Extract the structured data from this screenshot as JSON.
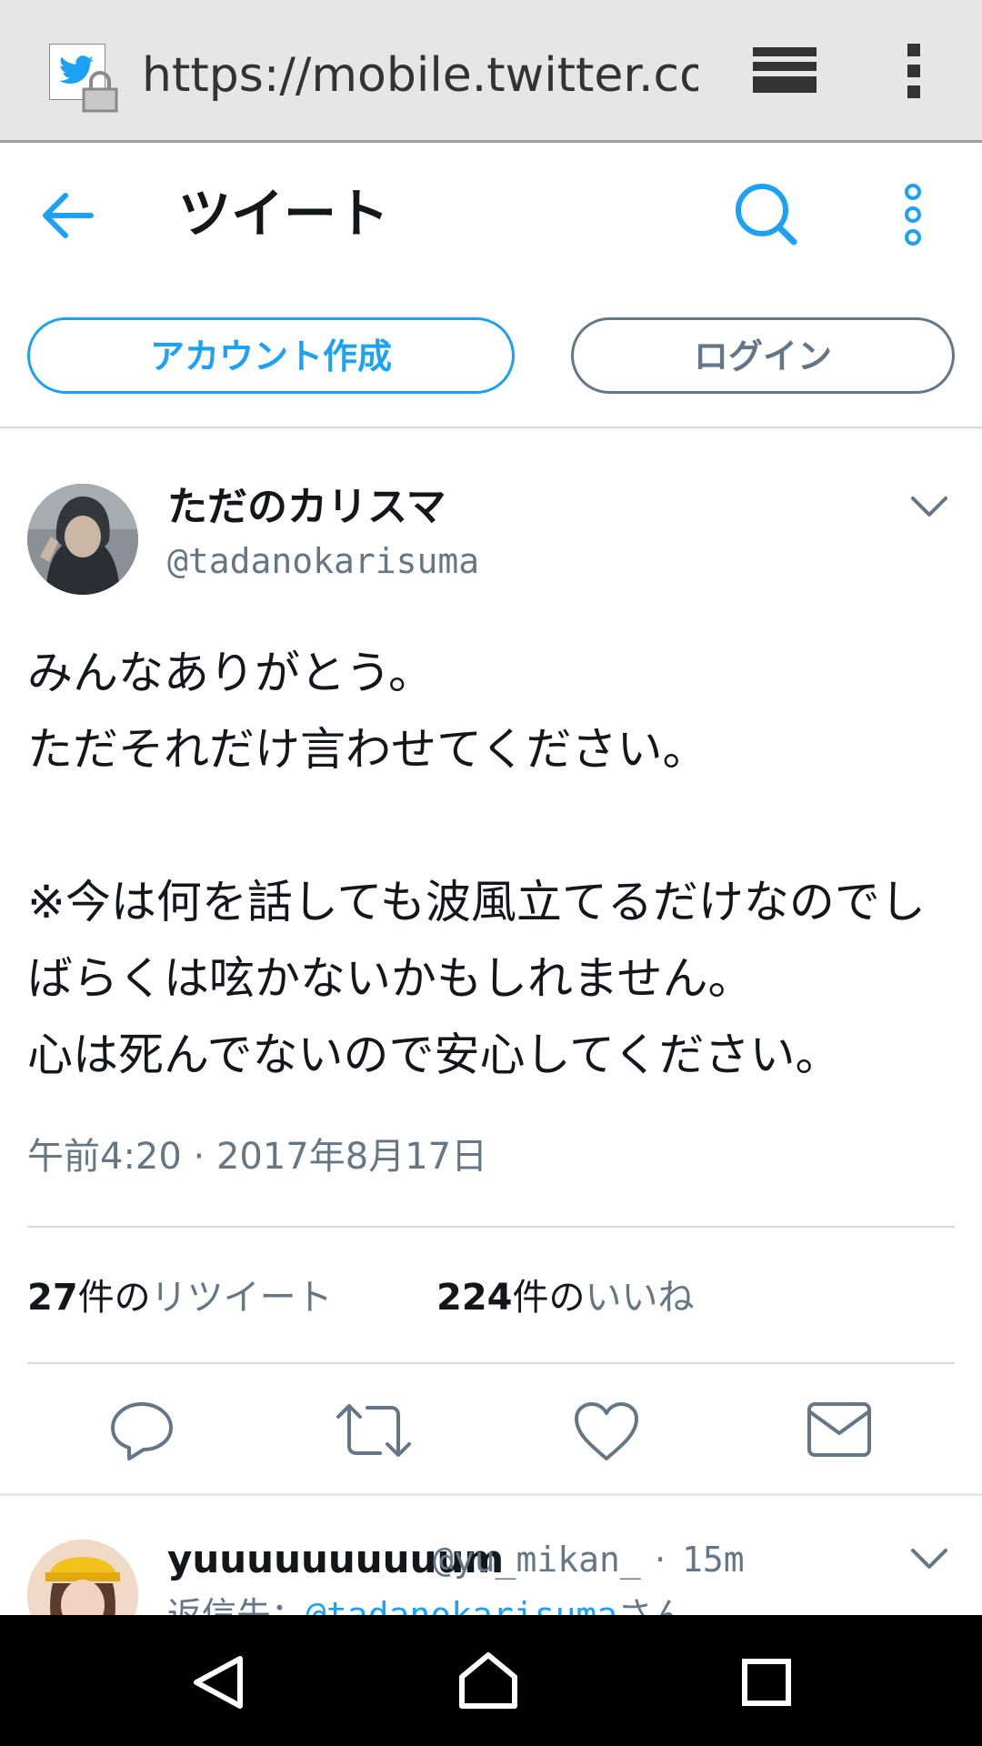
{
  "browser": {
    "url": "https://mobile.twitter.com",
    "icons": [
      "twitter-favicon",
      "lock-icon",
      "tabs-icon",
      "menu-icon"
    ]
  },
  "header": {
    "title": "ツイート",
    "icons": [
      "back-arrow-icon",
      "search-icon",
      "more-vertical-icon"
    ],
    "accent_color": "#1da1f2"
  },
  "auth": {
    "signup_label": "アカウント作成",
    "login_label": "ログイン"
  },
  "tweet": {
    "display_name": "ただのカリスマ",
    "handle": "@tadanokarisuma",
    "text": "みんなありがとう。\nただそれだけ言わせてください。\n\n※今は何を話しても波風立てるだけなのでしばらくは呟かないかもしれません。\n心は死んでないので安心してください。",
    "timestamp": "午前4:20 · 2017年8月17日",
    "retweets": {
      "count": "27",
      "unit": "件の",
      "label": "リツイート"
    },
    "likes": {
      "count": "224",
      "unit": "件の",
      "label": "いいね"
    },
    "actions": [
      "reply-icon",
      "retweet-icon",
      "like-icon",
      "direct-message-icon"
    ]
  },
  "reply": {
    "display_name": "yuuuuuuuuuum",
    "handle": "@yu_mikan_",
    "separator": "·",
    "time": "15m",
    "reply_to_prefix": "返信先：",
    "reply_to_mention": "@tadanokarisuma",
    "reply_to_suffix": "さん"
  },
  "system_nav": {
    "icons": [
      "back-triangle-icon",
      "home-circle-icon",
      "recents-square-icon"
    ]
  }
}
